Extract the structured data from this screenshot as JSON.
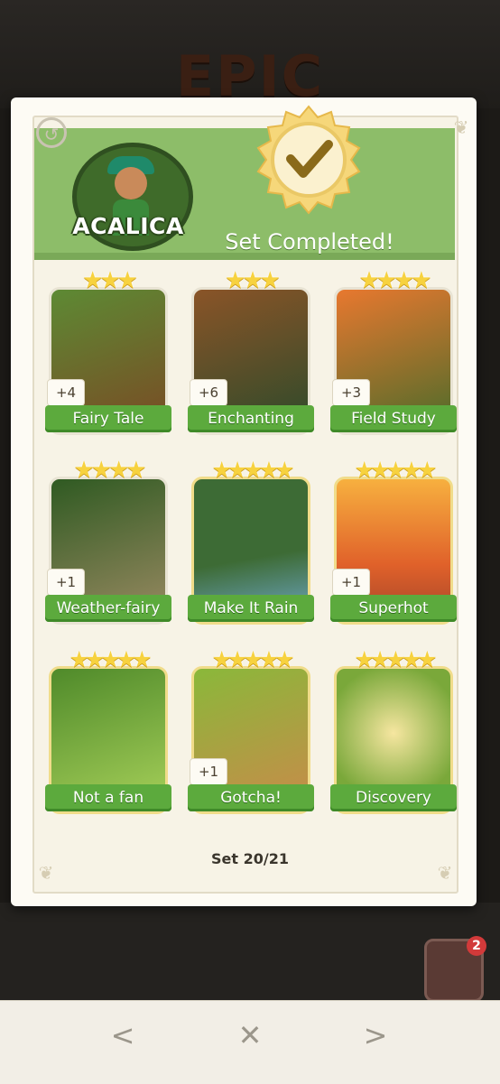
{
  "background": {
    "title": "EPIC",
    "chest_count": "2"
  },
  "header": {
    "set_name": "ACALICA",
    "status": "Set Completed!"
  },
  "cards": [
    {
      "name": "Fairy Tale",
      "stars": "★★★",
      "count": "+4",
      "art_colors": [
        "#4a6b2a",
        "#7a4a24"
      ]
    },
    {
      "name": "Enchanting",
      "stars": "★★★",
      "count": "+6",
      "art_colors": [
        "#6b3d1e",
        "#2d4a2a"
      ]
    },
    {
      "name": "Field Study",
      "stars": "★★★★",
      "count": "+3",
      "art_colors": [
        "#d8682c",
        "#4a6b2a"
      ]
    },
    {
      "name": "Weather-fairy",
      "stars": "★★★★",
      "count": "+1",
      "art_colors": [
        "#2f5a22",
        "#8a7a5a"
      ]
    },
    {
      "name": "Make It Rain",
      "stars": "★★★★★",
      "count": "",
      "art_colors": [
        "#3d6b35",
        "#6fa8c8"
      ]
    },
    {
      "name": "Superhot",
      "stars": "★★★★★",
      "count": "+1",
      "art_colors": [
        "#f2a13a",
        "#c04a2a"
      ]
    },
    {
      "name": "Not a fan",
      "stars": "★★★★★",
      "count": "",
      "art_colors": [
        "#4f8a2a",
        "#8bc34a"
      ]
    },
    {
      "name": "Gotcha!",
      "stars": "★★★★★",
      "count": "+1",
      "art_colors": [
        "#6b9a2a",
        "#c98a4a"
      ]
    },
    {
      "name": "Discovery",
      "stars": "★★★★★",
      "count": "",
      "art_colors": [
        "#7aa83a",
        "#f0d88a"
      ]
    }
  ],
  "progress": "Set 20/21",
  "nav": {
    "back": "<",
    "close": "✕",
    "forward": ">"
  },
  "icons": [
    "history-icon",
    "checkmark-icon",
    "star-icon",
    "chevron-left-icon",
    "close-icon",
    "chevron-right-icon"
  ],
  "colors": {
    "header_green": "#8dbd69",
    "label_green": "#5caa3d",
    "star_gold": "#f7d23f"
  }
}
